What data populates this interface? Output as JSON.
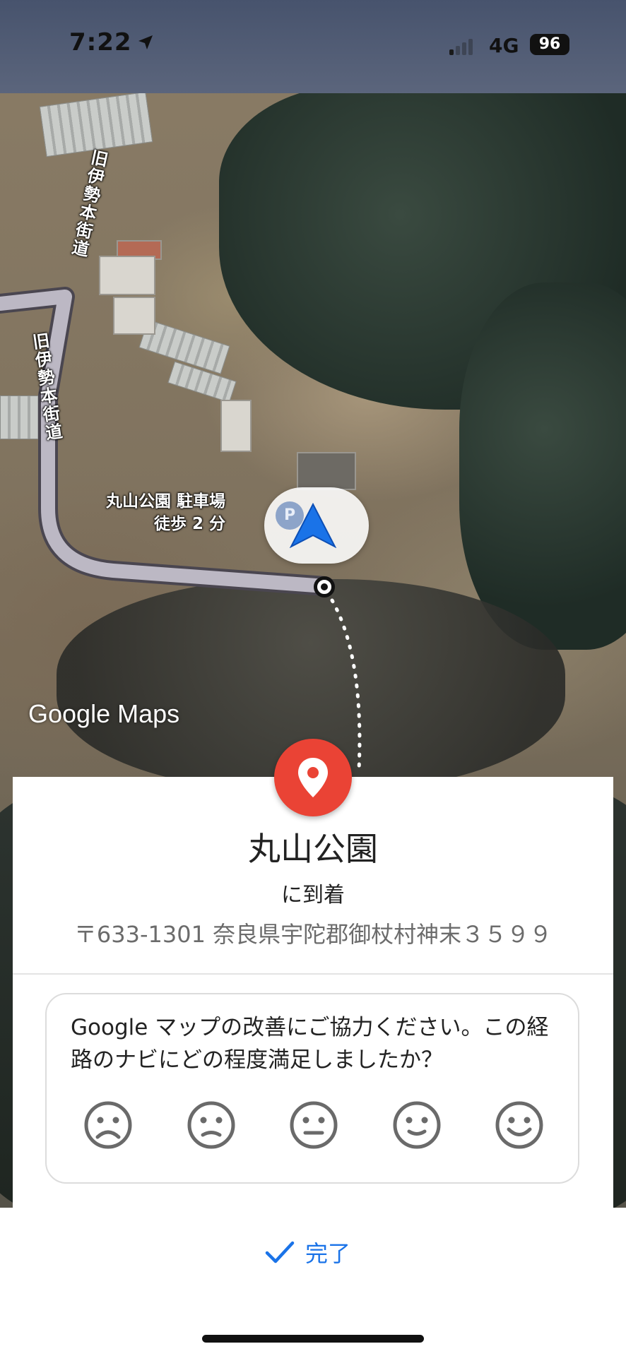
{
  "status_bar": {
    "time": "7:22",
    "network": "4G",
    "battery": "96"
  },
  "map": {
    "road_label_top": "旧伊勢本街道",
    "road_label_mid": "旧伊勢本街道",
    "parking_name": "丸山公園 駐車場",
    "parking_walk": "徒歩 2 分",
    "parking_symbol": "P",
    "watermark": "Google Maps",
    "route_color": "#b9b5c0",
    "nav_arrow_color": "#1a73e8"
  },
  "arrival": {
    "destination": "丸山公園",
    "arrived_text": "に到着",
    "address": "〒633-1301 奈良県宇陀郡御杖村神末３５９９",
    "pin_color": "#ea4335"
  },
  "survey": {
    "question": "Google マップの改善にご協力ください。この経路のナビにどの程度満足しましたか？",
    "faces": [
      "very-dissatisfied-icon",
      "dissatisfied-icon",
      "neutral-icon",
      "satisfied-icon",
      "very-satisfied-icon"
    ]
  },
  "footer": {
    "done_label": "完了",
    "accent_color": "#1a73e8"
  }
}
